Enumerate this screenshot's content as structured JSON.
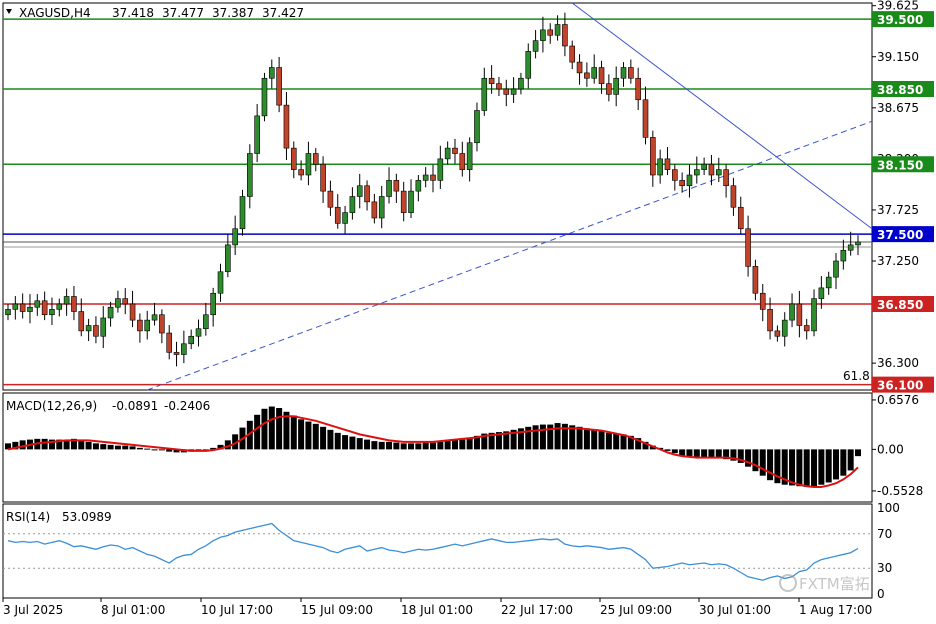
{
  "header": {
    "symbol": "XAGUSD,H4",
    "open": "37.418",
    "high": "37.477",
    "low": "37.387",
    "close": "37.427"
  },
  "macd_panel": {
    "title": "MACD(12,26,9)",
    "macd": "-0.0891",
    "signal": "-0.2406"
  },
  "rsi_panel": {
    "title": "RSI(14)",
    "value": "53.0989"
  },
  "fib_label": "61.8",
  "watermark": "FXTM富拓",
  "colors": {
    "bull": "#2e8b2e",
    "bear": "#c0432b",
    "resistance": "#1a8a1a",
    "support": "#cc2222",
    "pivot": "#0000cc",
    "trend": "#3a55cc",
    "signal": "#dd1111",
    "rsi": "#3b8fd8",
    "hist": "#000000"
  },
  "chart_data": [
    {
      "type": "candlestick",
      "instrument": "XAGUSD",
      "timeframe": "H4",
      "ylim": [
        36.05,
        39.65
      ],
      "y_ticks": [
        "39.625",
        "39.150",
        "38.675",
        "38.200",
        "37.725",
        "37.250",
        "36.300"
      ],
      "x_ticks": [
        "3 Jul 2025",
        "8 Jul 01:00",
        "10 Jul 17:00",
        "15 Jul 09:00",
        "18 Jul 01:00",
        "22 Jul 17:00",
        "25 Jul 09:00",
        "30 Jul 01:00",
        "1 Aug 17:00"
      ],
      "horizontal_levels": [
        {
          "value": 39.5,
          "label": "39.500",
          "kind": "resistance"
        },
        {
          "value": 38.85,
          "label": "38.850",
          "kind": "resistance"
        },
        {
          "value": 38.15,
          "label": "38.150",
          "kind": "resistance"
        },
        {
          "value": 37.5,
          "label": "37.500",
          "kind": "pivot"
        },
        {
          "value": 36.85,
          "label": "36.850",
          "kind": "support"
        },
        {
          "value": 36.1,
          "label": "36.100",
          "kind": "support"
        }
      ],
      "current_price": 37.427,
      "closes": [
        36.8,
        36.85,
        36.78,
        36.82,
        36.88,
        36.75,
        36.8,
        36.85,
        36.92,
        36.78,
        36.6,
        36.65,
        36.55,
        36.72,
        36.82,
        36.9,
        36.85,
        36.7,
        36.6,
        36.7,
        36.75,
        36.58,
        36.4,
        36.38,
        36.48,
        36.55,
        36.62,
        36.75,
        36.95,
        37.15,
        37.4,
        37.55,
        37.85,
        38.25,
        38.6,
        38.95,
        39.05,
        38.7,
        38.3,
        38.1,
        38.05,
        38.25,
        38.15,
        37.9,
        37.75,
        37.6,
        37.7,
        37.85,
        37.95,
        37.8,
        37.65,
        37.85,
        38.0,
        37.9,
        37.7,
        37.9,
        38.0,
        38.05,
        38.0,
        38.2,
        38.3,
        38.25,
        38.1,
        38.35,
        38.65,
        38.95,
        38.9,
        38.85,
        38.8,
        38.85,
        38.95,
        39.2,
        39.3,
        39.4,
        39.35,
        39.45,
        39.25,
        39.1,
        39.0,
        38.95,
        39.05,
        38.9,
        38.8,
        38.95,
        39.05,
        38.95,
        38.75,
        38.4,
        38.05,
        38.2,
        38.1,
        38.0,
        37.95,
        38.05,
        38.1,
        38.15,
        38.05,
        38.1,
        37.95,
        37.75,
        37.55,
        37.2,
        36.95,
        36.8,
        36.6,
        36.55,
        36.7,
        36.85,
        36.65,
        36.6,
        36.9,
        37.0,
        37.1,
        37.25,
        37.35,
        37.4,
        37.427
      ],
      "trend_lines": [
        {
          "kind": "descending",
          "from": {
            "date": "22 Jul",
            "value": 39.65
          },
          "to": {
            "date": "1 Aug",
            "value": 37.55
          }
        },
        {
          "kind": "ascending",
          "from": {
            "date": "8 Jul",
            "value": 36.05
          },
          "to": {
            "date": "1 Aug",
            "value": 38.55
          }
        }
      ]
    },
    {
      "type": "bar",
      "name": "MACD(12,26,9)",
      "y_ticks": [
        "0.6576",
        "0.00",
        "-0.5528"
      ],
      "ylim": [
        -0.7,
        0.75
      ],
      "histogram": [
        0.08,
        0.1,
        0.12,
        0.13,
        0.14,
        0.14,
        0.13,
        0.13,
        0.13,
        0.14,
        0.12,
        0.1,
        0.08,
        0.07,
        0.06,
        0.05,
        0.05,
        0.04,
        0.02,
        0.01,
        0.0,
        -0.01,
        -0.03,
        -0.04,
        -0.04,
        -0.03,
        -0.02,
        -0.01,
        0.02,
        0.06,
        0.12,
        0.2,
        0.29,
        0.38,
        0.46,
        0.54,
        0.57,
        0.55,
        0.5,
        0.45,
        0.4,
        0.37,
        0.34,
        0.3,
        0.26,
        0.22,
        0.19,
        0.17,
        0.15,
        0.13,
        0.11,
        0.1,
        0.1,
        0.09,
        0.08,
        0.08,
        0.08,
        0.09,
        0.09,
        0.1,
        0.12,
        0.13,
        0.13,
        0.15,
        0.18,
        0.21,
        0.22,
        0.23,
        0.24,
        0.26,
        0.28,
        0.3,
        0.32,
        0.33,
        0.33,
        0.35,
        0.34,
        0.32,
        0.3,
        0.28,
        0.27,
        0.25,
        0.22,
        0.21,
        0.2,
        0.18,
        0.15,
        0.1,
        0.05,
        0.02,
        -0.02,
        -0.05,
        -0.08,
        -0.1,
        -0.11,
        -0.12,
        -0.12,
        -0.12,
        -0.13,
        -0.15,
        -0.18,
        -0.23,
        -0.29,
        -0.35,
        -0.41,
        -0.45,
        -0.47,
        -0.48,
        -0.49,
        -0.5,
        -0.49,
        -0.47,
        -0.44,
        -0.4,
        -0.35,
        -0.28,
        -0.09
      ],
      "signal": [
        0.0,
        0.02,
        0.04,
        0.06,
        0.08,
        0.09,
        0.1,
        0.11,
        0.12,
        0.12,
        0.12,
        0.12,
        0.11,
        0.1,
        0.09,
        0.08,
        0.07,
        0.06,
        0.05,
        0.04,
        0.03,
        0.02,
        0.01,
        0.0,
        -0.01,
        -0.02,
        -0.02,
        -0.02,
        -0.01,
        0.01,
        0.04,
        0.08,
        0.14,
        0.21,
        0.28,
        0.35,
        0.4,
        0.43,
        0.44,
        0.44,
        0.42,
        0.4,
        0.38,
        0.35,
        0.32,
        0.29,
        0.26,
        0.23,
        0.2,
        0.18,
        0.16,
        0.14,
        0.12,
        0.11,
        0.1,
        0.1,
        0.1,
        0.1,
        0.1,
        0.11,
        0.12,
        0.13,
        0.14,
        0.15,
        0.16,
        0.18,
        0.19,
        0.2,
        0.21,
        0.22,
        0.23,
        0.24,
        0.25,
        0.26,
        0.27,
        0.28,
        0.28,
        0.28,
        0.28,
        0.27,
        0.26,
        0.25,
        0.23,
        0.21,
        0.19,
        0.16,
        0.12,
        0.08,
        0.04,
        0.0,
        -0.04,
        -0.07,
        -0.09,
        -0.1,
        -0.11,
        -0.11,
        -0.11,
        -0.11,
        -0.11,
        -0.12,
        -0.14,
        -0.17,
        -0.21,
        -0.26,
        -0.31,
        -0.36,
        -0.4,
        -0.44,
        -0.47,
        -0.49,
        -0.5,
        -0.5,
        -0.48,
        -0.45,
        -0.4,
        -0.33,
        -0.24
      ]
    },
    {
      "type": "line",
      "name": "RSI(14)",
      "y_ticks": [
        "100",
        "70",
        "30",
        "0"
      ],
      "ylim": [
        0,
        100
      ],
      "levels": [
        70,
        30
      ],
      "values": [
        62,
        60,
        61,
        60,
        61,
        58,
        60,
        62,
        59,
        55,
        56,
        54,
        52,
        55,
        57,
        56,
        52,
        54,
        50,
        46,
        44,
        40,
        36,
        42,
        45,
        46,
        52,
        56,
        62,
        66,
        68,
        72,
        74,
        76,
        78,
        80,
        82,
        74,
        68,
        62,
        60,
        58,
        56,
        54,
        50,
        48,
        52,
        54,
        56,
        50,
        52,
        54,
        51,
        50,
        48,
        50,
        52,
        51,
        52,
        54,
        56,
        58,
        56,
        58,
        60,
        62,
        64,
        62,
        60,
        60,
        61,
        62,
        63,
        64,
        63,
        64,
        58,
        56,
        55,
        56,
        55,
        54,
        52,
        53,
        54,
        52,
        46,
        40,
        30,
        31,
        32,
        34,
        36,
        34,
        35,
        36,
        34,
        35,
        34,
        30,
        25,
        20,
        18,
        16,
        19,
        21,
        18,
        20,
        26,
        28,
        36,
        40,
        42,
        44,
        46,
        48,
        53
      ]
    }
  ]
}
